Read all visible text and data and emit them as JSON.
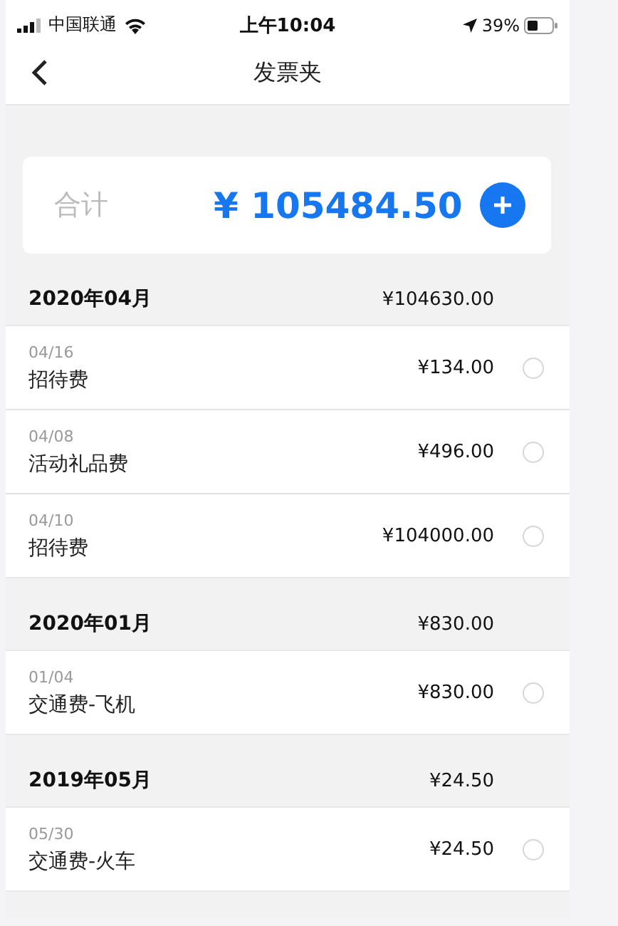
{
  "status_bar": {
    "carrier": "中国联通",
    "time": "上午10:04",
    "battery": "39%"
  },
  "nav": {
    "title": "发票夹"
  },
  "summary": {
    "label": "合计",
    "total": "¥ 105484.50"
  },
  "groups": [
    {
      "month": "2020年04月",
      "total": "¥104630.00",
      "items": [
        {
          "date": "04/16",
          "name": "招待费",
          "amount": "¥134.00",
          "selected": false
        },
        {
          "date": "04/08",
          "name": "活动礼品费",
          "amount": "¥496.00",
          "selected": false
        },
        {
          "date": "04/10",
          "name": "招待费",
          "amount": "¥104000.00",
          "selected": false
        }
      ]
    },
    {
      "month": "2020年01月",
      "total": "¥830.00",
      "items": [
        {
          "date": "01/04",
          "name": "交通费-飞机",
          "amount": "¥830.00",
          "selected": false
        }
      ]
    },
    {
      "month": "2019年05月",
      "total": "¥24.50",
      "items": [
        {
          "date": "05/30",
          "name": "交通费-火车",
          "amount": "¥24.50",
          "selected": false
        }
      ]
    }
  ]
}
